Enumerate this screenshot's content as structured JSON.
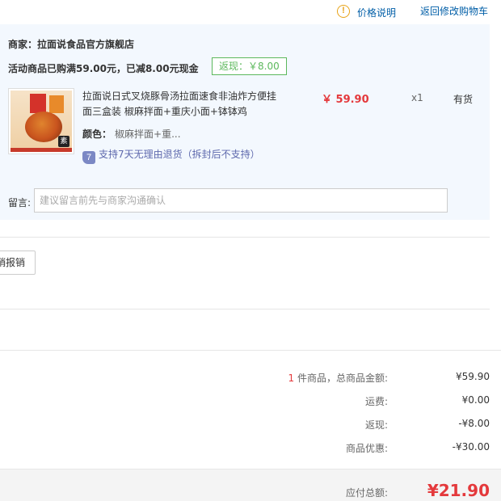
{
  "top_links": {
    "warn_symbol": "!",
    "price_help": "价格说明",
    "back_to_cart": "返回修改购物车"
  },
  "shop": {
    "title": "商家：拉面说食品官方旗舰店",
    "promo": "活动商品已购满59.00元，已减8.00元现金",
    "rebate": "返现：￥8.00"
  },
  "product": {
    "thumb_mark": "素",
    "name": "拉面说日式叉烧豚骨汤拉面速食非油炸方便挂面三盒装 椒麻拌面+重庆小面+钵钵鸡",
    "price": "￥ 59.90",
    "qty": "x1",
    "stock": "有货",
    "color_label": "颜色：",
    "color_value": "椒麻拌面+重...",
    "return_icon": "7",
    "return_policy": "支持7天无理由退货（拆封后不支持）"
  },
  "memo": {
    "label": "留言:",
    "placeholder": "建议留言前先与商家沟通确认"
  },
  "invoice": {
    "button_label": "销报销"
  },
  "summary": {
    "count": "1",
    "count_suffix": " 件商品，总商品金额:",
    "total_goods": "¥59.90",
    "shipping_label": "运费:",
    "shipping": "¥0.00",
    "rebate_label": "返现:",
    "rebate": "-¥8.00",
    "discount_label": "商品优惠:",
    "discount": "-¥30.00",
    "payable_label": "应付总额:",
    "payable": "¥21.90"
  },
  "colors": {
    "accent_red": "#e4393c",
    "link_blue": "#005ea7",
    "panel_bg": "#f3f8fe",
    "rebate_green": "#5cb85c"
  }
}
